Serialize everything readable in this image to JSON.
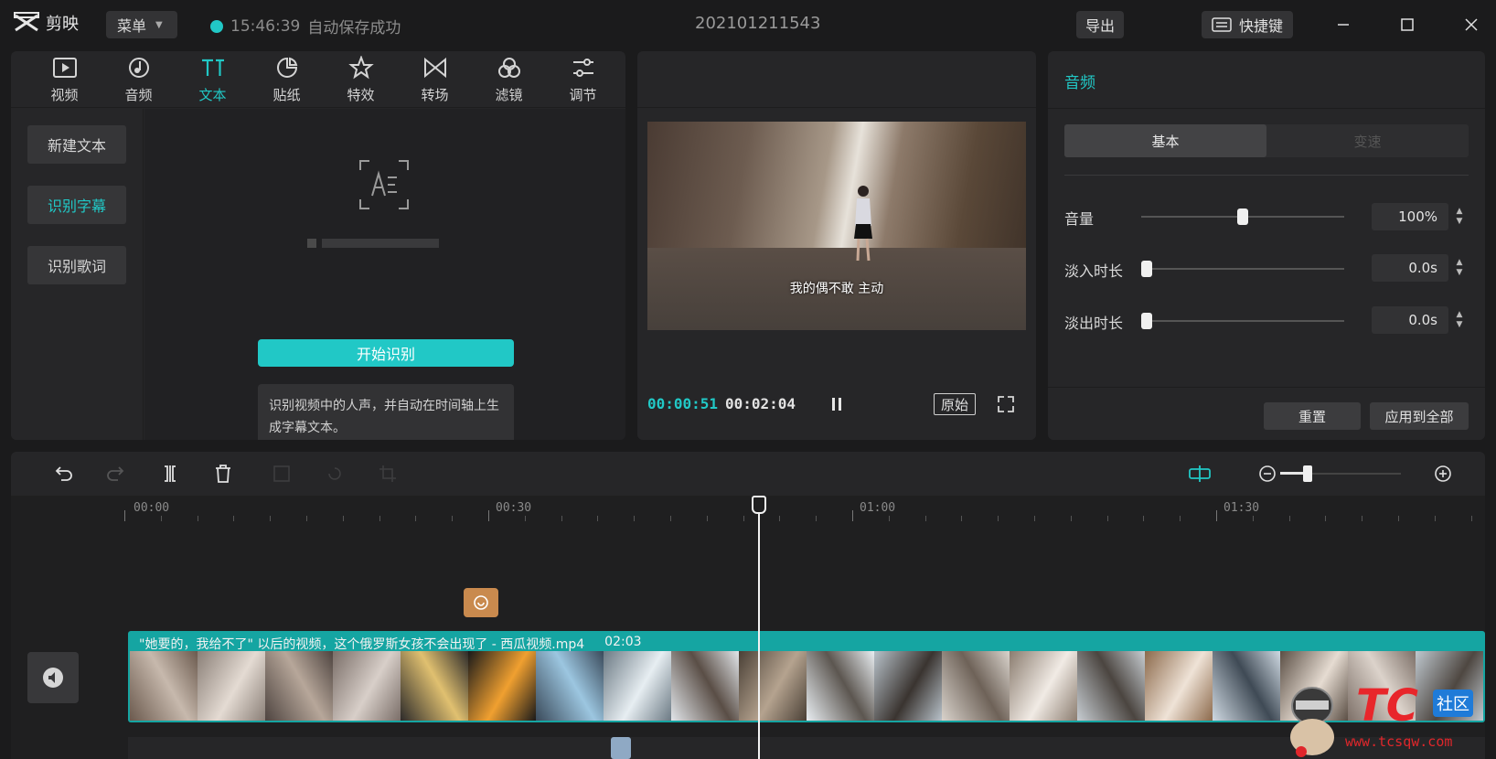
{
  "app": {
    "name": "剪映",
    "menu_label": "菜单",
    "save_time": "15:46:39",
    "save_status": "自动保存成功",
    "project_title": "202101211543",
    "export_label": "导出",
    "shortcut_label": "快捷键"
  },
  "media_tabs": [
    {
      "label": "视频",
      "icon": "video-icon"
    },
    {
      "label": "音频",
      "icon": "audio-icon"
    },
    {
      "label": "文本",
      "icon": "text-icon"
    },
    {
      "label": "贴纸",
      "icon": "sticker-icon"
    },
    {
      "label": "特效",
      "icon": "effects-icon"
    },
    {
      "label": "转场",
      "icon": "transition-icon"
    },
    {
      "label": "滤镜",
      "icon": "filter-icon"
    },
    {
      "label": "调节",
      "icon": "adjust-icon"
    }
  ],
  "active_tab": "文本",
  "text_sidebar": {
    "items": [
      "新建文本",
      "识别字幕",
      "识别歌词"
    ],
    "active": "识别字幕"
  },
  "recognize": {
    "start_label": "开始识别",
    "description": "识别视频中的人声，并自动在时间轴上生成字幕文本。"
  },
  "player": {
    "subtitle": "我的偶不敢 主动",
    "current_time": "00:00:51",
    "total_time": "00:02:04",
    "original_label": "原始"
  },
  "audio_panel": {
    "title": "音频",
    "tabs": [
      "基本",
      "变速"
    ],
    "active_tab": "基本",
    "params": [
      {
        "label": "音量",
        "value": "100%",
        "level": 0.5
      },
      {
        "label": "淡入时长",
        "value": "0.0s",
        "level": 0
      },
      {
        "label": "淡出时长",
        "value": "0.0s",
        "level": 0
      }
    ],
    "reset_label": "重置",
    "apply_all_label": "应用到全部"
  },
  "timeline": {
    "ruler_labels": [
      "00:00",
      "00:30",
      "01:00",
      "01:30"
    ],
    "clip_title": "\"她要的，我给不了\" 以后的视频，这个俄罗斯女孩不会出现了 - 西瓜视频.mp4",
    "clip_duration": "02:03",
    "zoom_level": 0.25
  },
  "watermark": {
    "logo": "TC",
    "badge": "社区",
    "url": "www.tcsqw.com"
  },
  "colors": {
    "accent": "#21c8c6",
    "panel_bg": "#262628",
    "app_bg": "#1b1b1c",
    "clip_bg": "#15a5a2"
  }
}
